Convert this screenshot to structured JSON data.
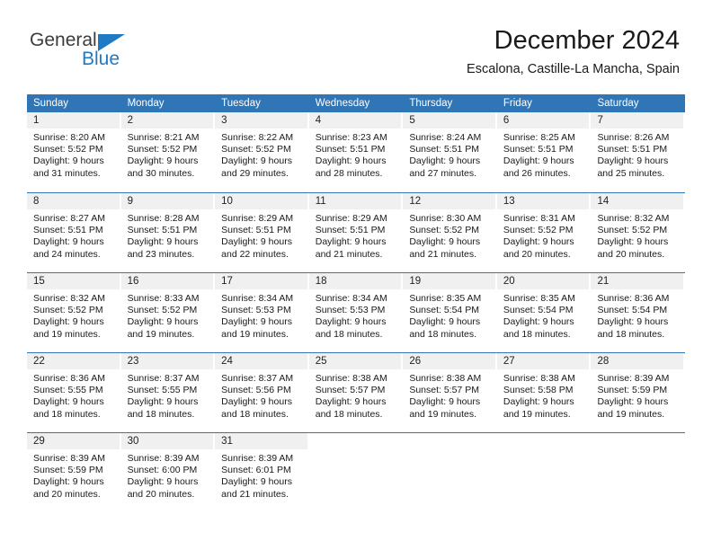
{
  "brand": {
    "name_part1": "General",
    "name_part2": "Blue"
  },
  "header": {
    "title": "December 2024",
    "subtitle": "Escalona, Castille-La Mancha, Spain"
  },
  "colors": {
    "header_blue": "#3075b5",
    "brand_blue": "#1f7ac4",
    "daynum_band": "#f0f0f0"
  },
  "weekdays": [
    "Sunday",
    "Monday",
    "Tuesday",
    "Wednesday",
    "Thursday",
    "Friday",
    "Saturday"
  ],
  "weeks": [
    [
      {
        "day": "1",
        "sunrise": "Sunrise: 8:20 AM",
        "sunset": "Sunset: 5:52 PM",
        "daylight1": "Daylight: 9 hours",
        "daylight2": "and 31 minutes."
      },
      {
        "day": "2",
        "sunrise": "Sunrise: 8:21 AM",
        "sunset": "Sunset: 5:52 PM",
        "daylight1": "Daylight: 9 hours",
        "daylight2": "and 30 minutes."
      },
      {
        "day": "3",
        "sunrise": "Sunrise: 8:22 AM",
        "sunset": "Sunset: 5:52 PM",
        "daylight1": "Daylight: 9 hours",
        "daylight2": "and 29 minutes."
      },
      {
        "day": "4",
        "sunrise": "Sunrise: 8:23 AM",
        "sunset": "Sunset: 5:51 PM",
        "daylight1": "Daylight: 9 hours",
        "daylight2": "and 28 minutes."
      },
      {
        "day": "5",
        "sunrise": "Sunrise: 8:24 AM",
        "sunset": "Sunset: 5:51 PM",
        "daylight1": "Daylight: 9 hours",
        "daylight2": "and 27 minutes."
      },
      {
        "day": "6",
        "sunrise": "Sunrise: 8:25 AM",
        "sunset": "Sunset: 5:51 PM",
        "daylight1": "Daylight: 9 hours",
        "daylight2": "and 26 minutes."
      },
      {
        "day": "7",
        "sunrise": "Sunrise: 8:26 AM",
        "sunset": "Sunset: 5:51 PM",
        "daylight1": "Daylight: 9 hours",
        "daylight2": "and 25 minutes."
      }
    ],
    [
      {
        "day": "8",
        "sunrise": "Sunrise: 8:27 AM",
        "sunset": "Sunset: 5:51 PM",
        "daylight1": "Daylight: 9 hours",
        "daylight2": "and 24 minutes."
      },
      {
        "day": "9",
        "sunrise": "Sunrise: 8:28 AM",
        "sunset": "Sunset: 5:51 PM",
        "daylight1": "Daylight: 9 hours",
        "daylight2": "and 23 minutes."
      },
      {
        "day": "10",
        "sunrise": "Sunrise: 8:29 AM",
        "sunset": "Sunset: 5:51 PM",
        "daylight1": "Daylight: 9 hours",
        "daylight2": "and 22 minutes."
      },
      {
        "day": "11",
        "sunrise": "Sunrise: 8:29 AM",
        "sunset": "Sunset: 5:51 PM",
        "daylight1": "Daylight: 9 hours",
        "daylight2": "and 21 minutes."
      },
      {
        "day": "12",
        "sunrise": "Sunrise: 8:30 AM",
        "sunset": "Sunset: 5:52 PM",
        "daylight1": "Daylight: 9 hours",
        "daylight2": "and 21 minutes."
      },
      {
        "day": "13",
        "sunrise": "Sunrise: 8:31 AM",
        "sunset": "Sunset: 5:52 PM",
        "daylight1": "Daylight: 9 hours",
        "daylight2": "and 20 minutes."
      },
      {
        "day": "14",
        "sunrise": "Sunrise: 8:32 AM",
        "sunset": "Sunset: 5:52 PM",
        "daylight1": "Daylight: 9 hours",
        "daylight2": "and 20 minutes."
      }
    ],
    [
      {
        "day": "15",
        "sunrise": "Sunrise: 8:32 AM",
        "sunset": "Sunset: 5:52 PM",
        "daylight1": "Daylight: 9 hours",
        "daylight2": "and 19 minutes."
      },
      {
        "day": "16",
        "sunrise": "Sunrise: 8:33 AM",
        "sunset": "Sunset: 5:52 PM",
        "daylight1": "Daylight: 9 hours",
        "daylight2": "and 19 minutes."
      },
      {
        "day": "17",
        "sunrise": "Sunrise: 8:34 AM",
        "sunset": "Sunset: 5:53 PM",
        "daylight1": "Daylight: 9 hours",
        "daylight2": "and 19 minutes."
      },
      {
        "day": "18",
        "sunrise": "Sunrise: 8:34 AM",
        "sunset": "Sunset: 5:53 PM",
        "daylight1": "Daylight: 9 hours",
        "daylight2": "and 18 minutes."
      },
      {
        "day": "19",
        "sunrise": "Sunrise: 8:35 AM",
        "sunset": "Sunset: 5:54 PM",
        "daylight1": "Daylight: 9 hours",
        "daylight2": "and 18 minutes."
      },
      {
        "day": "20",
        "sunrise": "Sunrise: 8:35 AM",
        "sunset": "Sunset: 5:54 PM",
        "daylight1": "Daylight: 9 hours",
        "daylight2": "and 18 minutes."
      },
      {
        "day": "21",
        "sunrise": "Sunrise: 8:36 AM",
        "sunset": "Sunset: 5:54 PM",
        "daylight1": "Daylight: 9 hours",
        "daylight2": "and 18 minutes."
      }
    ],
    [
      {
        "day": "22",
        "sunrise": "Sunrise: 8:36 AM",
        "sunset": "Sunset: 5:55 PM",
        "daylight1": "Daylight: 9 hours",
        "daylight2": "and 18 minutes."
      },
      {
        "day": "23",
        "sunrise": "Sunrise: 8:37 AM",
        "sunset": "Sunset: 5:55 PM",
        "daylight1": "Daylight: 9 hours",
        "daylight2": "and 18 minutes."
      },
      {
        "day": "24",
        "sunrise": "Sunrise: 8:37 AM",
        "sunset": "Sunset: 5:56 PM",
        "daylight1": "Daylight: 9 hours",
        "daylight2": "and 18 minutes."
      },
      {
        "day": "25",
        "sunrise": "Sunrise: 8:38 AM",
        "sunset": "Sunset: 5:57 PM",
        "daylight1": "Daylight: 9 hours",
        "daylight2": "and 18 minutes."
      },
      {
        "day": "26",
        "sunrise": "Sunrise: 8:38 AM",
        "sunset": "Sunset: 5:57 PM",
        "daylight1": "Daylight: 9 hours",
        "daylight2": "and 19 minutes."
      },
      {
        "day": "27",
        "sunrise": "Sunrise: 8:38 AM",
        "sunset": "Sunset: 5:58 PM",
        "daylight1": "Daylight: 9 hours",
        "daylight2": "and 19 minutes."
      },
      {
        "day": "28",
        "sunrise": "Sunrise: 8:39 AM",
        "sunset": "Sunset: 5:59 PM",
        "daylight1": "Daylight: 9 hours",
        "daylight2": "and 19 minutes."
      }
    ],
    [
      {
        "day": "29",
        "sunrise": "Sunrise: 8:39 AM",
        "sunset": "Sunset: 5:59 PM",
        "daylight1": "Daylight: 9 hours",
        "daylight2": "and 20 minutes."
      },
      {
        "day": "30",
        "sunrise": "Sunrise: 8:39 AM",
        "sunset": "Sunset: 6:00 PM",
        "daylight1": "Daylight: 9 hours",
        "daylight2": "and 20 minutes."
      },
      {
        "day": "31",
        "sunrise": "Sunrise: 8:39 AM",
        "sunset": "Sunset: 6:01 PM",
        "daylight1": "Daylight: 9 hours",
        "daylight2": "and 21 minutes."
      },
      {
        "day": "",
        "sunrise": "",
        "sunset": "",
        "daylight1": "",
        "daylight2": ""
      },
      {
        "day": "",
        "sunrise": "",
        "sunset": "",
        "daylight1": "",
        "daylight2": ""
      },
      {
        "day": "",
        "sunrise": "",
        "sunset": "",
        "daylight1": "",
        "daylight2": ""
      },
      {
        "day": "",
        "sunrise": "",
        "sunset": "",
        "daylight1": "",
        "daylight2": ""
      }
    ]
  ]
}
